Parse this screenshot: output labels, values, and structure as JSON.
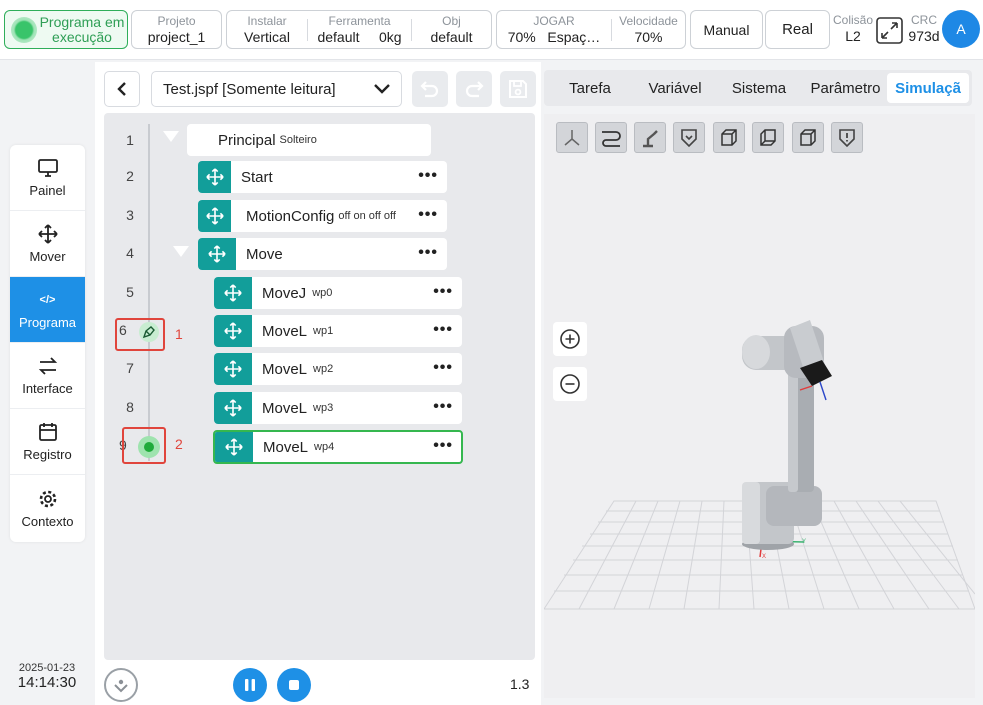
{
  "header": {
    "status": "Programa em execução",
    "project": {
      "label": "Projeto",
      "value": "project_1"
    },
    "install": {
      "label": "Instalar",
      "value": "Vertical"
    },
    "tool": {
      "label": "Ferramenta",
      "name": "default",
      "weight": "0kg"
    },
    "obj": {
      "label": "Obj",
      "value": "default"
    },
    "jog": {
      "label": "JOGAR",
      "speed": "70%",
      "space": "Espaç…"
    },
    "velocity": {
      "label": "Velocidade",
      "value": "70%"
    },
    "mode_button": "Manual",
    "real_button": "Real",
    "collision": {
      "label": "Colisão",
      "value": "L2"
    },
    "crc": {
      "label": "CRC",
      "value": "973d"
    },
    "avatar": "A"
  },
  "nav": {
    "items": [
      {
        "label": "Painel",
        "icon": "monitor-icon"
      },
      {
        "label": "Mover",
        "icon": "move-icon"
      },
      {
        "label": "Programa",
        "icon": "code-icon"
      },
      {
        "label": "Interface",
        "icon": "swap-icon"
      },
      {
        "label": "Registro",
        "icon": "calendar-icon"
      },
      {
        "label": "Contexto",
        "icon": "gear-icon"
      }
    ],
    "active": "Programa"
  },
  "clock": {
    "date": "2025-01-23",
    "time": "14:14:30"
  },
  "program": {
    "file": "Test.jspf [Somente leitura]",
    "lines": [
      "1",
      "2",
      "3",
      "4",
      "5",
      "6",
      "7",
      "8",
      "9"
    ],
    "nodes": [
      {
        "name": "Principal",
        "sub": "Solteiro"
      },
      {
        "name": "Start",
        "sub": ""
      },
      {
        "name": "MotionConfig",
        "sub": "off on off off"
      },
      {
        "name": "Move",
        "sub": ""
      },
      {
        "name": "MoveJ",
        "sub": "wp0"
      },
      {
        "name": "MoveL",
        "sub": "wp1"
      },
      {
        "name": "MoveL",
        "sub": "wp2"
      },
      {
        "name": "MoveL",
        "sub": "wp3"
      },
      {
        "name": "MoveL",
        "sub": "wp4"
      }
    ],
    "markers": [
      "1",
      "2"
    ],
    "speed": "1.3"
  },
  "tabs": [
    "Tarefa",
    "Variável",
    "Sistema",
    "Parâmetro",
    "Simulaçã"
  ],
  "active_tab": "Simulaçã",
  "colors": {
    "accent": "#1e90e6",
    "teal": "#129e9a",
    "running": "#2fae5a",
    "marker": "#e0453c"
  }
}
